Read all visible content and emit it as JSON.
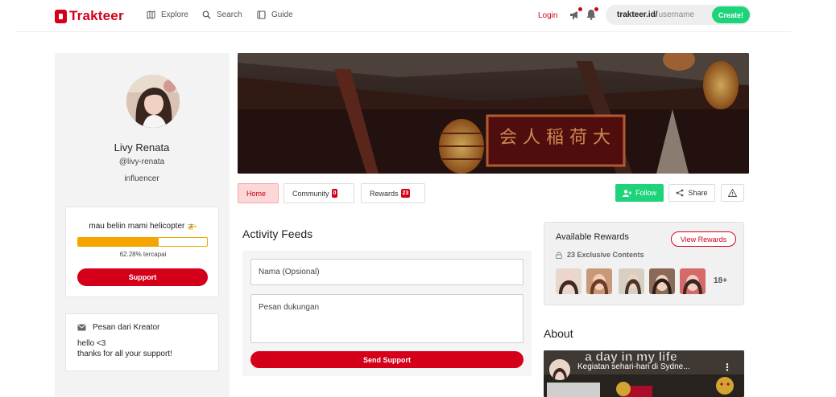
{
  "nav": {
    "brand": "Trakteer",
    "links": [
      {
        "label": "Explore",
        "icon": "map-icon"
      },
      {
        "label": "Search",
        "icon": "search-icon"
      },
      {
        "label": "Guide",
        "icon": "book-icon"
      }
    ],
    "login": "Login",
    "url_domain": "trakteer.id/",
    "url_placeholder": "username",
    "create": "Create!"
  },
  "profile": {
    "name": "Livy Renata",
    "handle": "@livy-renata",
    "category": "influencer"
  },
  "goal": {
    "title": "mau beliin mami helicopter 🚁",
    "progress_percent": 62.28,
    "progress_text": "62.28% tercapai",
    "support": "Support"
  },
  "message": {
    "title": "Pesan dari Kreator",
    "lines": [
      "hello <3",
      "thanks for all your support!"
    ]
  },
  "tabs": [
    {
      "label": "Home",
      "count": null
    },
    {
      "label": "Community",
      "count": "0"
    },
    {
      "label": "Rewards",
      "count": "23"
    }
  ],
  "actions": {
    "follow": "Follow",
    "share": "Share"
  },
  "activity": {
    "title": "Activity Feeds",
    "name_placeholder": "Nama (Opsional)",
    "message_placeholder": "Pesan dukungan",
    "send": "Send Support"
  },
  "rewards": {
    "title": "Available Rewards",
    "view": "View Rewards",
    "exclusive": "23 Exclusive Contents",
    "more": "18+"
  },
  "about": {
    "title": "About",
    "video_overlay": "a day in my life",
    "video_title": "Kegiatan sehari-hari di Sydne..."
  },
  "colors": {
    "brand_red": "#d4001a",
    "green": "#1ed47a",
    "progress": "#f5a400"
  }
}
